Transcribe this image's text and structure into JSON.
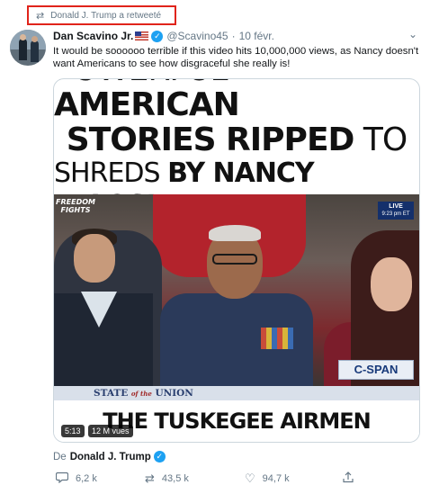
{
  "retweet_notice": "Donald J. Trump a retweeté",
  "tweet": {
    "author_name": "Dan Scavino Jr.",
    "handle": "@Scavino45",
    "separator": "·",
    "date": "10 févr.",
    "text": "It would be soooooo terrible if this video hits 10,000,000 views, as Nancy doesn't want Americans to see how disgraceful she really is!"
  },
  "media": {
    "headline_line1_a": "Powerful ",
    "headline_line1_b": "American",
    "headline_line2_a": "Stories Ripped",
    "headline_line2_b": " to",
    "headline_line3_a": "Shreds ",
    "headline_line3_b": "by Nancy Pelosi",
    "logo_text": "FREEDOM FIGHTS",
    "live_label": "LIVE",
    "live_time": "9:23 pm ET",
    "network": "C-SPAN",
    "banner_a": "STATE",
    "banner_the": "of the",
    "banner_b": "UNION",
    "caption": "THE TUSKEGEE AIRMEN",
    "duration": "5:13",
    "views": "12 M vues"
  },
  "source": {
    "prefix": "De",
    "name": "Donald J. Trump"
  },
  "actions": {
    "replies": "6,2 k",
    "retweets": "43,5 k",
    "likes": "94,7 k"
  },
  "icons": {
    "retweet": "retweet-icon",
    "verified": "verified-badge-icon",
    "reply": "reply-icon",
    "like": "heart-icon",
    "share": "share-icon",
    "menu": "chevron-down-icon"
  },
  "colors": {
    "highlight_border": "#e0241b",
    "verified_blue": "#1da1f2",
    "muted_text": "#657786"
  }
}
